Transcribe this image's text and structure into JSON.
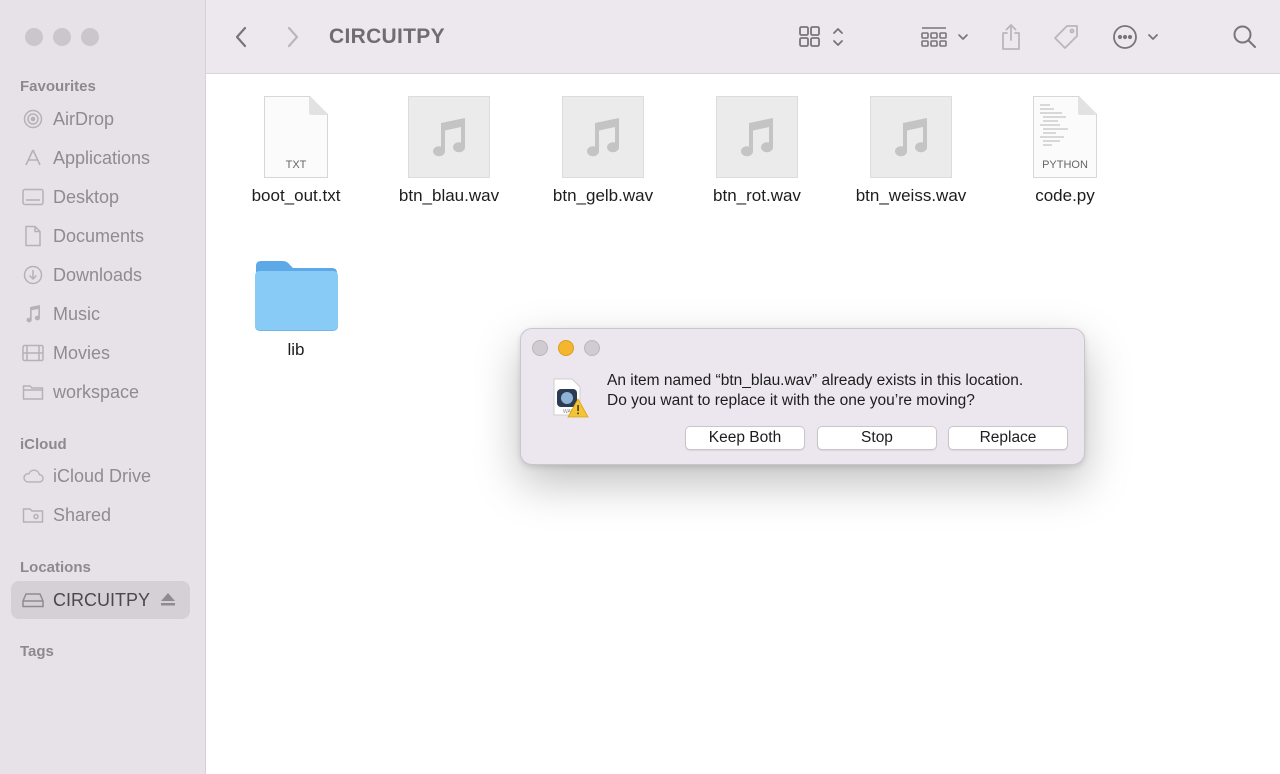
{
  "window": {
    "title": "CIRCUITPY"
  },
  "sidebar": {
    "sections": [
      {
        "heading": "Favourites"
      },
      {
        "heading": "iCloud"
      },
      {
        "heading": "Locations"
      },
      {
        "heading": "Tags"
      }
    ],
    "favourites": [
      {
        "label": "AirDrop",
        "icon": "airdrop-icon"
      },
      {
        "label": "Applications",
        "icon": "applications-icon"
      },
      {
        "label": "Desktop",
        "icon": "desktop-icon"
      },
      {
        "label": "Documents",
        "icon": "document-icon"
      },
      {
        "label": "Downloads",
        "icon": "download-icon"
      },
      {
        "label": "Music",
        "icon": "music-note-icon"
      },
      {
        "label": "Movies",
        "icon": "film-icon"
      },
      {
        "label": "workspace",
        "icon": "folder-icon"
      }
    ],
    "icloud": [
      {
        "label": "iCloud Drive",
        "icon": "cloud-icon"
      },
      {
        "label": "Shared",
        "icon": "shared-folder-icon"
      }
    ],
    "locations": [
      {
        "label": "CIRCUITPY",
        "icon": "drive-icon",
        "selected": true
      }
    ]
  },
  "files": [
    {
      "name": "boot_out.txt",
      "kind": "TXT"
    },
    {
      "name": "btn_blau.wav",
      "kind": "audio"
    },
    {
      "name": "btn_gelb.wav",
      "kind": "audio"
    },
    {
      "name": "btn_rot.wav",
      "kind": "audio"
    },
    {
      "name": "btn_weiss.wav",
      "kind": "audio"
    },
    {
      "name": "code.py",
      "kind": "PYTHON"
    },
    {
      "name": "lib",
      "kind": "folder"
    }
  ],
  "dialog": {
    "message_line1": "An item named “btn_blau.wav” already exists in this location.",
    "message_line2": "Do you want to replace it with the one you’re moving?",
    "buttons": {
      "keep_both": "Keep Both",
      "stop": "Stop",
      "replace": "Replace"
    }
  },
  "colors": {
    "sidebar_bg": "#e7e2e8",
    "folder_blue": "#7cc3f5",
    "dialog_min": "#f4b52f"
  }
}
